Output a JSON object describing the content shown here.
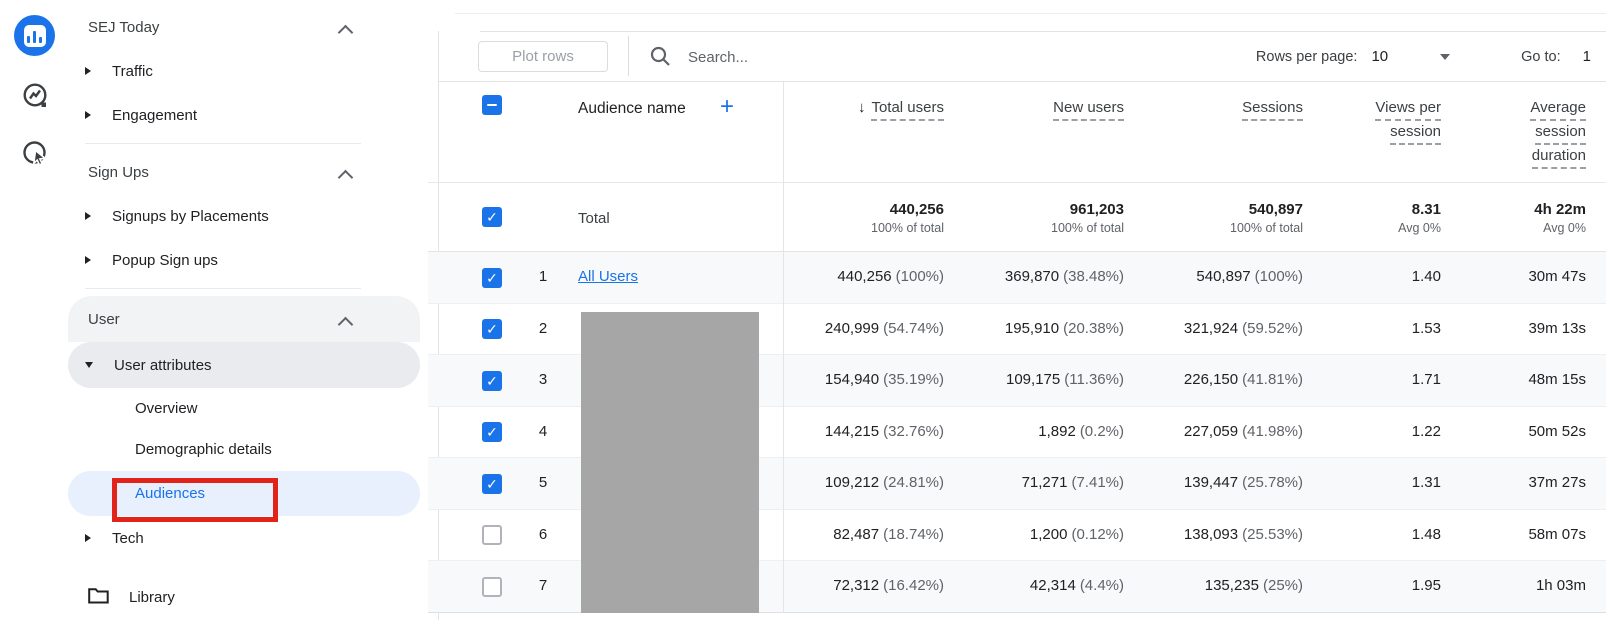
{
  "colors": {
    "accent": "#1a73e8",
    "annotation_red": "#e2231a",
    "redaction_gray": "#a6a6a6",
    "active_pill_blue": "#e8f0fe"
  },
  "left_rail": {
    "icons": [
      "reports-icon",
      "explore-icon",
      "advertising-icon"
    ]
  },
  "sidebar": {
    "items": [
      {
        "label": "SEJ Today",
        "type": "section"
      },
      {
        "label": "Traffic",
        "type": "collapsed"
      },
      {
        "label": "Engagement",
        "type": "collapsed"
      },
      {
        "label": "Sign Ups",
        "type": "section"
      },
      {
        "label": "Signups by Placements",
        "type": "collapsed"
      },
      {
        "label": "Popup Sign ups",
        "type": "collapsed"
      },
      {
        "label": "User",
        "type": "section"
      },
      {
        "label": "User attributes",
        "type": "expanded"
      },
      {
        "label": "Overview",
        "type": "sub"
      },
      {
        "label": "Demographic details",
        "type": "sub"
      },
      {
        "label": "Audiences",
        "type": "sub-active"
      },
      {
        "label": "Tech",
        "type": "collapsed"
      },
      {
        "label": "Library",
        "type": "library"
      }
    ]
  },
  "toolbar": {
    "plot_rows_label": "Plot rows",
    "search_placeholder": "Search...",
    "rows_per_page_label": "Rows per page:",
    "rows_per_page_value": "10",
    "go_to_label": "Go to:",
    "go_to_value": "1"
  },
  "table": {
    "columns": {
      "name_header": "Audience name",
      "plus_label": "+",
      "metrics": [
        {
          "key": "total-users",
          "lines": [
            "Total users"
          ],
          "sorted": true
        },
        {
          "key": "new-users",
          "lines": [
            "New users"
          ],
          "sorted": false
        },
        {
          "key": "sessions",
          "lines": [
            "Sessions"
          ],
          "sorted": false
        },
        {
          "key": "views-per-session",
          "lines": [
            "Views per",
            "session"
          ],
          "sorted": false
        },
        {
          "key": "average-session-duration",
          "lines": [
            "Average",
            "session",
            "duration"
          ],
          "sorted": false
        }
      ]
    },
    "total": {
      "label": "Total",
      "cells": [
        {
          "value": "440,256",
          "sub": "100% of total"
        },
        {
          "value": "961,203",
          "sub": "100% of total"
        },
        {
          "value": "540,897",
          "sub": "100% of total"
        },
        {
          "value": "8.31",
          "sub": "Avg 0%"
        },
        {
          "value": "4h 22m",
          "sub": "Avg 0%"
        }
      ]
    },
    "rows": [
      {
        "num": "1",
        "name": "All Users",
        "checked": true,
        "redacted": false,
        "cells": [
          [
            "440,256",
            "(100%)"
          ],
          [
            "369,870",
            "(38.48%)"
          ],
          [
            "540,897",
            "(100%)"
          ],
          [
            "1.40",
            ""
          ],
          [
            "30m 47s",
            ""
          ]
        ]
      },
      {
        "num": "2",
        "name": "",
        "checked": true,
        "redacted": true,
        "cells": [
          [
            "240,999",
            "(54.74%)"
          ],
          [
            "195,910",
            "(20.38%)"
          ],
          [
            "321,924",
            "(59.52%)"
          ],
          [
            "1.53",
            ""
          ],
          [
            "39m 13s",
            ""
          ]
        ]
      },
      {
        "num": "3",
        "name": "",
        "checked": true,
        "redacted": true,
        "cells": [
          [
            "154,940",
            "(35.19%)"
          ],
          [
            "109,175",
            "(11.36%)"
          ],
          [
            "226,150",
            "(41.81%)"
          ],
          [
            "1.71",
            ""
          ],
          [
            "48m 15s",
            ""
          ]
        ]
      },
      {
        "num": "4",
        "name": "",
        "checked": true,
        "redacted": true,
        "cells": [
          [
            "144,215",
            "(32.76%)"
          ],
          [
            "1,892",
            "(0.2%)"
          ],
          [
            "227,059",
            "(41.98%)"
          ],
          [
            "1.22",
            ""
          ],
          [
            "50m 52s",
            ""
          ]
        ]
      },
      {
        "num": "5",
        "name": "",
        "checked": true,
        "redacted": true,
        "cells": [
          [
            "109,212",
            "(24.81%)"
          ],
          [
            "71,271",
            "(7.41%)"
          ],
          [
            "139,447",
            "(25.78%)"
          ],
          [
            "1.31",
            ""
          ],
          [
            "37m 27s",
            ""
          ]
        ]
      },
      {
        "num": "6",
        "name": "",
        "checked": false,
        "redacted": true,
        "cells": [
          [
            "82,487",
            "(18.74%)"
          ],
          [
            "1,200",
            "(0.12%)"
          ],
          [
            "138,093",
            "(25.53%)"
          ],
          [
            "1.48",
            ""
          ],
          [
            "58m 07s",
            ""
          ]
        ]
      },
      {
        "num": "7",
        "name": "",
        "checked": false,
        "redacted": true,
        "cells": [
          [
            "72,312",
            "(16.42%)"
          ],
          [
            "42,314",
            "(4.4%)"
          ],
          [
            "135,235",
            "(25%)"
          ],
          [
            "1.95",
            ""
          ],
          [
            "1h 03m",
            ""
          ]
        ]
      }
    ]
  }
}
